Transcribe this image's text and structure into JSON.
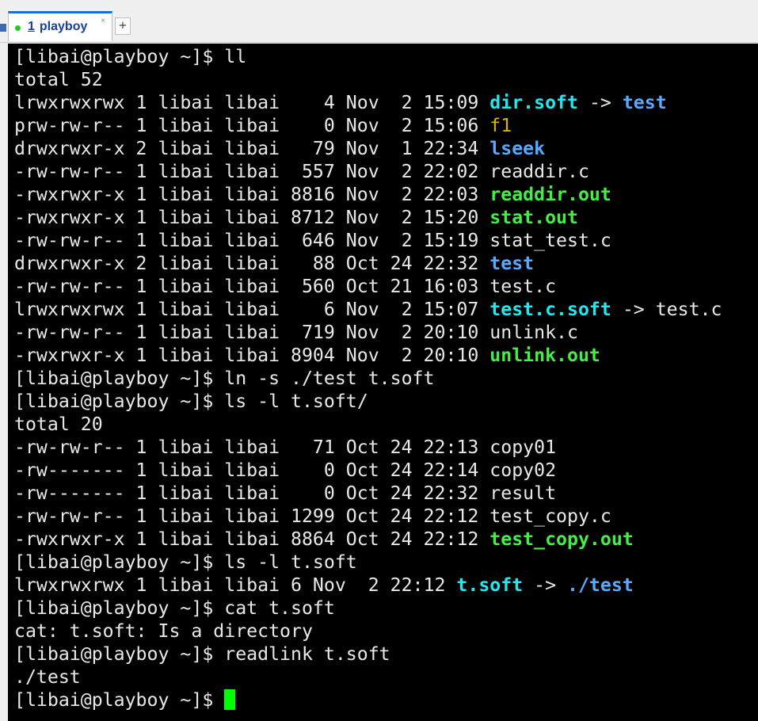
{
  "tab": {
    "number": "1",
    "title": "playboy",
    "close_glyph": "×",
    "new_tab_glyph": "+",
    "status_color": "#26c826"
  },
  "colors": {
    "background": "#000000",
    "text": "#e8e8e8",
    "symlink": "#22e8f0",
    "directory": "#5aa8ff",
    "executable": "#44ee44",
    "fifo": "#d6b400",
    "cursor": "#00ff00"
  },
  "lines": [
    {
      "segments": [
        {
          "t": "[libai@playboy ~]$ ll",
          "c": "plain"
        }
      ]
    },
    {
      "segments": [
        {
          "t": "total 52",
          "c": "plain"
        }
      ]
    },
    {
      "segments": [
        {
          "t": "lrwxrwxrwx 1 libai libai    4 Nov  2 15:09 ",
          "c": "plain"
        },
        {
          "t": "dir.soft",
          "c": "cyan"
        },
        {
          "t": " -> ",
          "c": "plain"
        },
        {
          "t": "test",
          "c": "blue"
        }
      ]
    },
    {
      "segments": [
        {
          "t": "prw-rw-r-- 1 libai libai    0 Nov  2 15:06 ",
          "c": "plain"
        },
        {
          "t": "f1",
          "c": "yellow"
        }
      ]
    },
    {
      "segments": [
        {
          "t": "drwxrwxr-x 2 libai libai   79 Nov  1 22:34 ",
          "c": "plain"
        },
        {
          "t": "lseek",
          "c": "blue"
        }
      ]
    },
    {
      "segments": [
        {
          "t": "-rw-rw-r-- 1 libai libai  557 Nov  2 22:02 readdir.c",
          "c": "plain"
        }
      ]
    },
    {
      "segments": [
        {
          "t": "-rwxrwxr-x 1 libai libai 8816 Nov  2 22:03 ",
          "c": "plain"
        },
        {
          "t": "readdir.out",
          "c": "green"
        }
      ]
    },
    {
      "segments": [
        {
          "t": "-rwxrwxr-x 1 libai libai 8712 Nov  2 15:20 ",
          "c": "plain"
        },
        {
          "t": "stat.out",
          "c": "green"
        }
      ]
    },
    {
      "segments": [
        {
          "t": "-rw-rw-r-- 1 libai libai  646 Nov  2 15:19 stat_test.c",
          "c": "plain"
        }
      ]
    },
    {
      "segments": [
        {
          "t": "drwxrwxr-x 2 libai libai   88 Oct 24 22:32 ",
          "c": "plain"
        },
        {
          "t": "test",
          "c": "blue"
        }
      ]
    },
    {
      "segments": [
        {
          "t": "-rw-rw-r-- 1 libai libai  560 Oct 21 16:03 test.c",
          "c": "plain"
        }
      ]
    },
    {
      "segments": [
        {
          "t": "lrwxrwxrwx 1 libai libai    6 Nov  2 15:07 ",
          "c": "plain"
        },
        {
          "t": "test.c.soft",
          "c": "cyan"
        },
        {
          "t": " -> test.c",
          "c": "plain"
        }
      ]
    },
    {
      "segments": [
        {
          "t": "-rw-rw-r-- 1 libai libai  719 Nov  2 20:10 unlink.c",
          "c": "plain"
        }
      ]
    },
    {
      "segments": [
        {
          "t": "-rwxrwxr-x 1 libai libai 8904 Nov  2 20:10 ",
          "c": "plain"
        },
        {
          "t": "unlink.out",
          "c": "green"
        }
      ]
    },
    {
      "segments": [
        {
          "t": "[libai@playboy ~]$ ln -s ./test t.soft",
          "c": "plain"
        }
      ]
    },
    {
      "segments": [
        {
          "t": "[libai@playboy ~]$ ls -l t.soft/",
          "c": "plain"
        }
      ]
    },
    {
      "segments": [
        {
          "t": "total 20",
          "c": "plain"
        }
      ]
    },
    {
      "segments": [
        {
          "t": "-rw-rw-r-- 1 libai libai   71 Oct 24 22:13 copy01",
          "c": "plain"
        }
      ]
    },
    {
      "segments": [
        {
          "t": "-rw------- 1 libai libai    0 Oct 24 22:14 copy02",
          "c": "plain"
        }
      ]
    },
    {
      "segments": [
        {
          "t": "-rw------- 1 libai libai    0 Oct 24 22:32 result",
          "c": "plain"
        }
      ]
    },
    {
      "segments": [
        {
          "t": "-rw-rw-r-- 1 libai libai 1299 Oct 24 22:12 test_copy.c",
          "c": "plain"
        }
      ]
    },
    {
      "segments": [
        {
          "t": "-rwxrwxr-x 1 libai libai 8864 Oct 24 22:12 ",
          "c": "plain"
        },
        {
          "t": "test_copy.out",
          "c": "green"
        }
      ]
    },
    {
      "segments": [
        {
          "t": "[libai@playboy ~]$ ls -l t.soft",
          "c": "plain"
        }
      ]
    },
    {
      "segments": [
        {
          "t": "lrwxrwxrwx 1 libai libai 6 Nov  2 22:12 ",
          "c": "plain"
        },
        {
          "t": "t.soft",
          "c": "cyan"
        },
        {
          "t": " -> ",
          "c": "plain"
        },
        {
          "t": "./test",
          "c": "blue"
        }
      ]
    },
    {
      "segments": [
        {
          "t": "[libai@playboy ~]$ cat t.soft",
          "c": "plain"
        }
      ]
    },
    {
      "segments": [
        {
          "t": "cat: t.soft: Is a directory",
          "c": "plain"
        }
      ]
    },
    {
      "segments": [
        {
          "t": "[libai@playboy ~]$ readlink t.soft",
          "c": "plain"
        }
      ]
    },
    {
      "segments": [
        {
          "t": "./test",
          "c": "plain"
        }
      ]
    },
    {
      "segments": [
        {
          "t": "[libai@playboy ~]$ ",
          "c": "plain"
        }
      ],
      "cursor": true
    }
  ]
}
